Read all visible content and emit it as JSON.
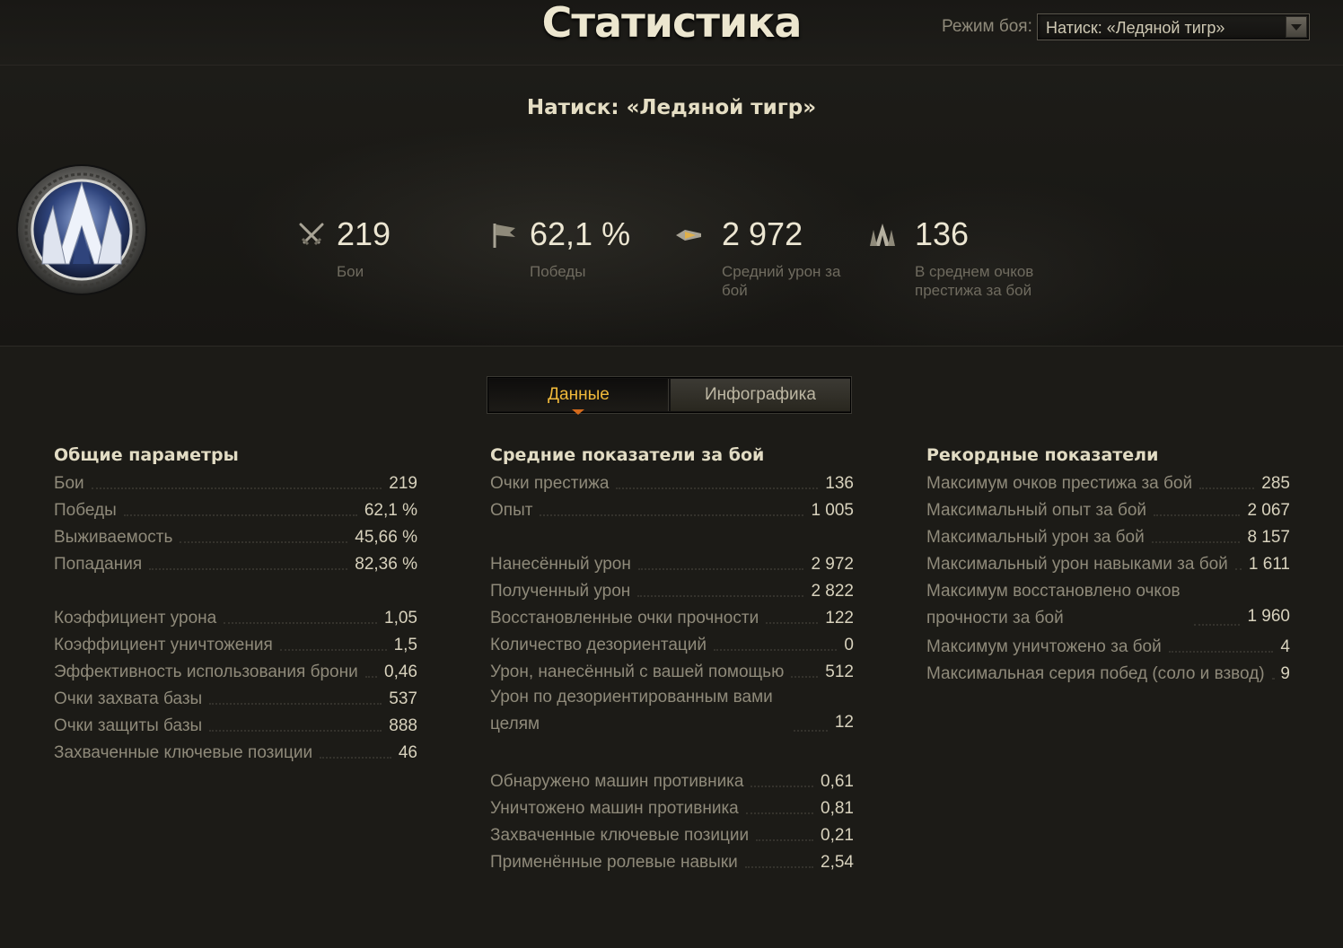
{
  "header": {
    "title": "Статистика",
    "mode_label": "Режим боя:",
    "mode_selected": "Натиск: «Ледяной тигр»"
  },
  "hero": {
    "mode_heading": "Натиск: «Ледяной тигр»",
    "stats": [
      {
        "icon": "crossed-swords-icon",
        "value": "219",
        "label": "Бои"
      },
      {
        "icon": "flag-icon",
        "value": "62,1 %",
        "label": "Победы"
      },
      {
        "icon": "shell-burst-icon",
        "value": "2 972",
        "label": "Средний урон за бой"
      },
      {
        "icon": "prestige-icon",
        "value": "136",
        "label": "В среднем очков престижа за бой"
      }
    ]
  },
  "tabs": {
    "data": "Данные",
    "infographic": "Инфографика",
    "active": "data"
  },
  "general": {
    "title": "Общие параметры",
    "rows": [
      {
        "label": "Бои",
        "value": "219"
      },
      {
        "label": "Победы",
        "value": "62,1 %"
      },
      {
        "label": "Выживаемость",
        "value": "45,66 %"
      },
      {
        "label": "Попадания",
        "value": "82,36 %"
      },
      {
        "label": "Коэффициент урона",
        "value": "1,05"
      },
      {
        "label": "Коэффициент уничтожения",
        "value": "1,5"
      },
      {
        "label": "Эффективность использования брони",
        "value": "0,46"
      },
      {
        "label": "Очки захвата базы",
        "value": "537"
      },
      {
        "label": "Очки защиты базы",
        "value": "888"
      },
      {
        "label": "Захваченные ключевые позиции",
        "value": "46"
      }
    ]
  },
  "average": {
    "title": "Средние показатели за бой",
    "rows": [
      {
        "label": "Очки престижа",
        "value": "136"
      },
      {
        "label": "Опыт",
        "value": "1 005"
      },
      {
        "label": "Нанесённый урон",
        "value": "2 972"
      },
      {
        "label": "Полученный урон",
        "value": "2 822"
      },
      {
        "label": "Восстановленные очки прочности",
        "value": "122"
      },
      {
        "label": "Количество дезориентаций",
        "value": "0"
      },
      {
        "label": "Урон, нанесённый с вашей помощью",
        "value": "512"
      },
      {
        "label": "Урон по дезориентированным вами целям",
        "value": "12"
      },
      {
        "label": "Обнаружено машин противника",
        "value": "0,61"
      },
      {
        "label": "Уничтожено машин противника",
        "value": "0,81"
      },
      {
        "label": "Захваченные ключевые позиции",
        "value": "0,21"
      },
      {
        "label": "Применённые ролевые навыки",
        "value": "2,54"
      }
    ]
  },
  "records": {
    "title": "Рекордные показатели",
    "rows": [
      {
        "label": "Максимум очков престижа за бой",
        "value": "285"
      },
      {
        "label": "Максимальный опыт за бой",
        "value": "2 067"
      },
      {
        "label": "Максимальный урон за бой",
        "value": "8 157"
      },
      {
        "label": "Максимальный урон навыками за бой",
        "value": "1 611"
      },
      {
        "label": "Максимум восстановлено очков прочности за бой",
        "value": "1 960"
      },
      {
        "label": "Максимум уничтожено за бой",
        "value": "4"
      },
      {
        "label": "Максимальная серия побед (соло и взвод)",
        "value": "9"
      }
    ]
  }
}
